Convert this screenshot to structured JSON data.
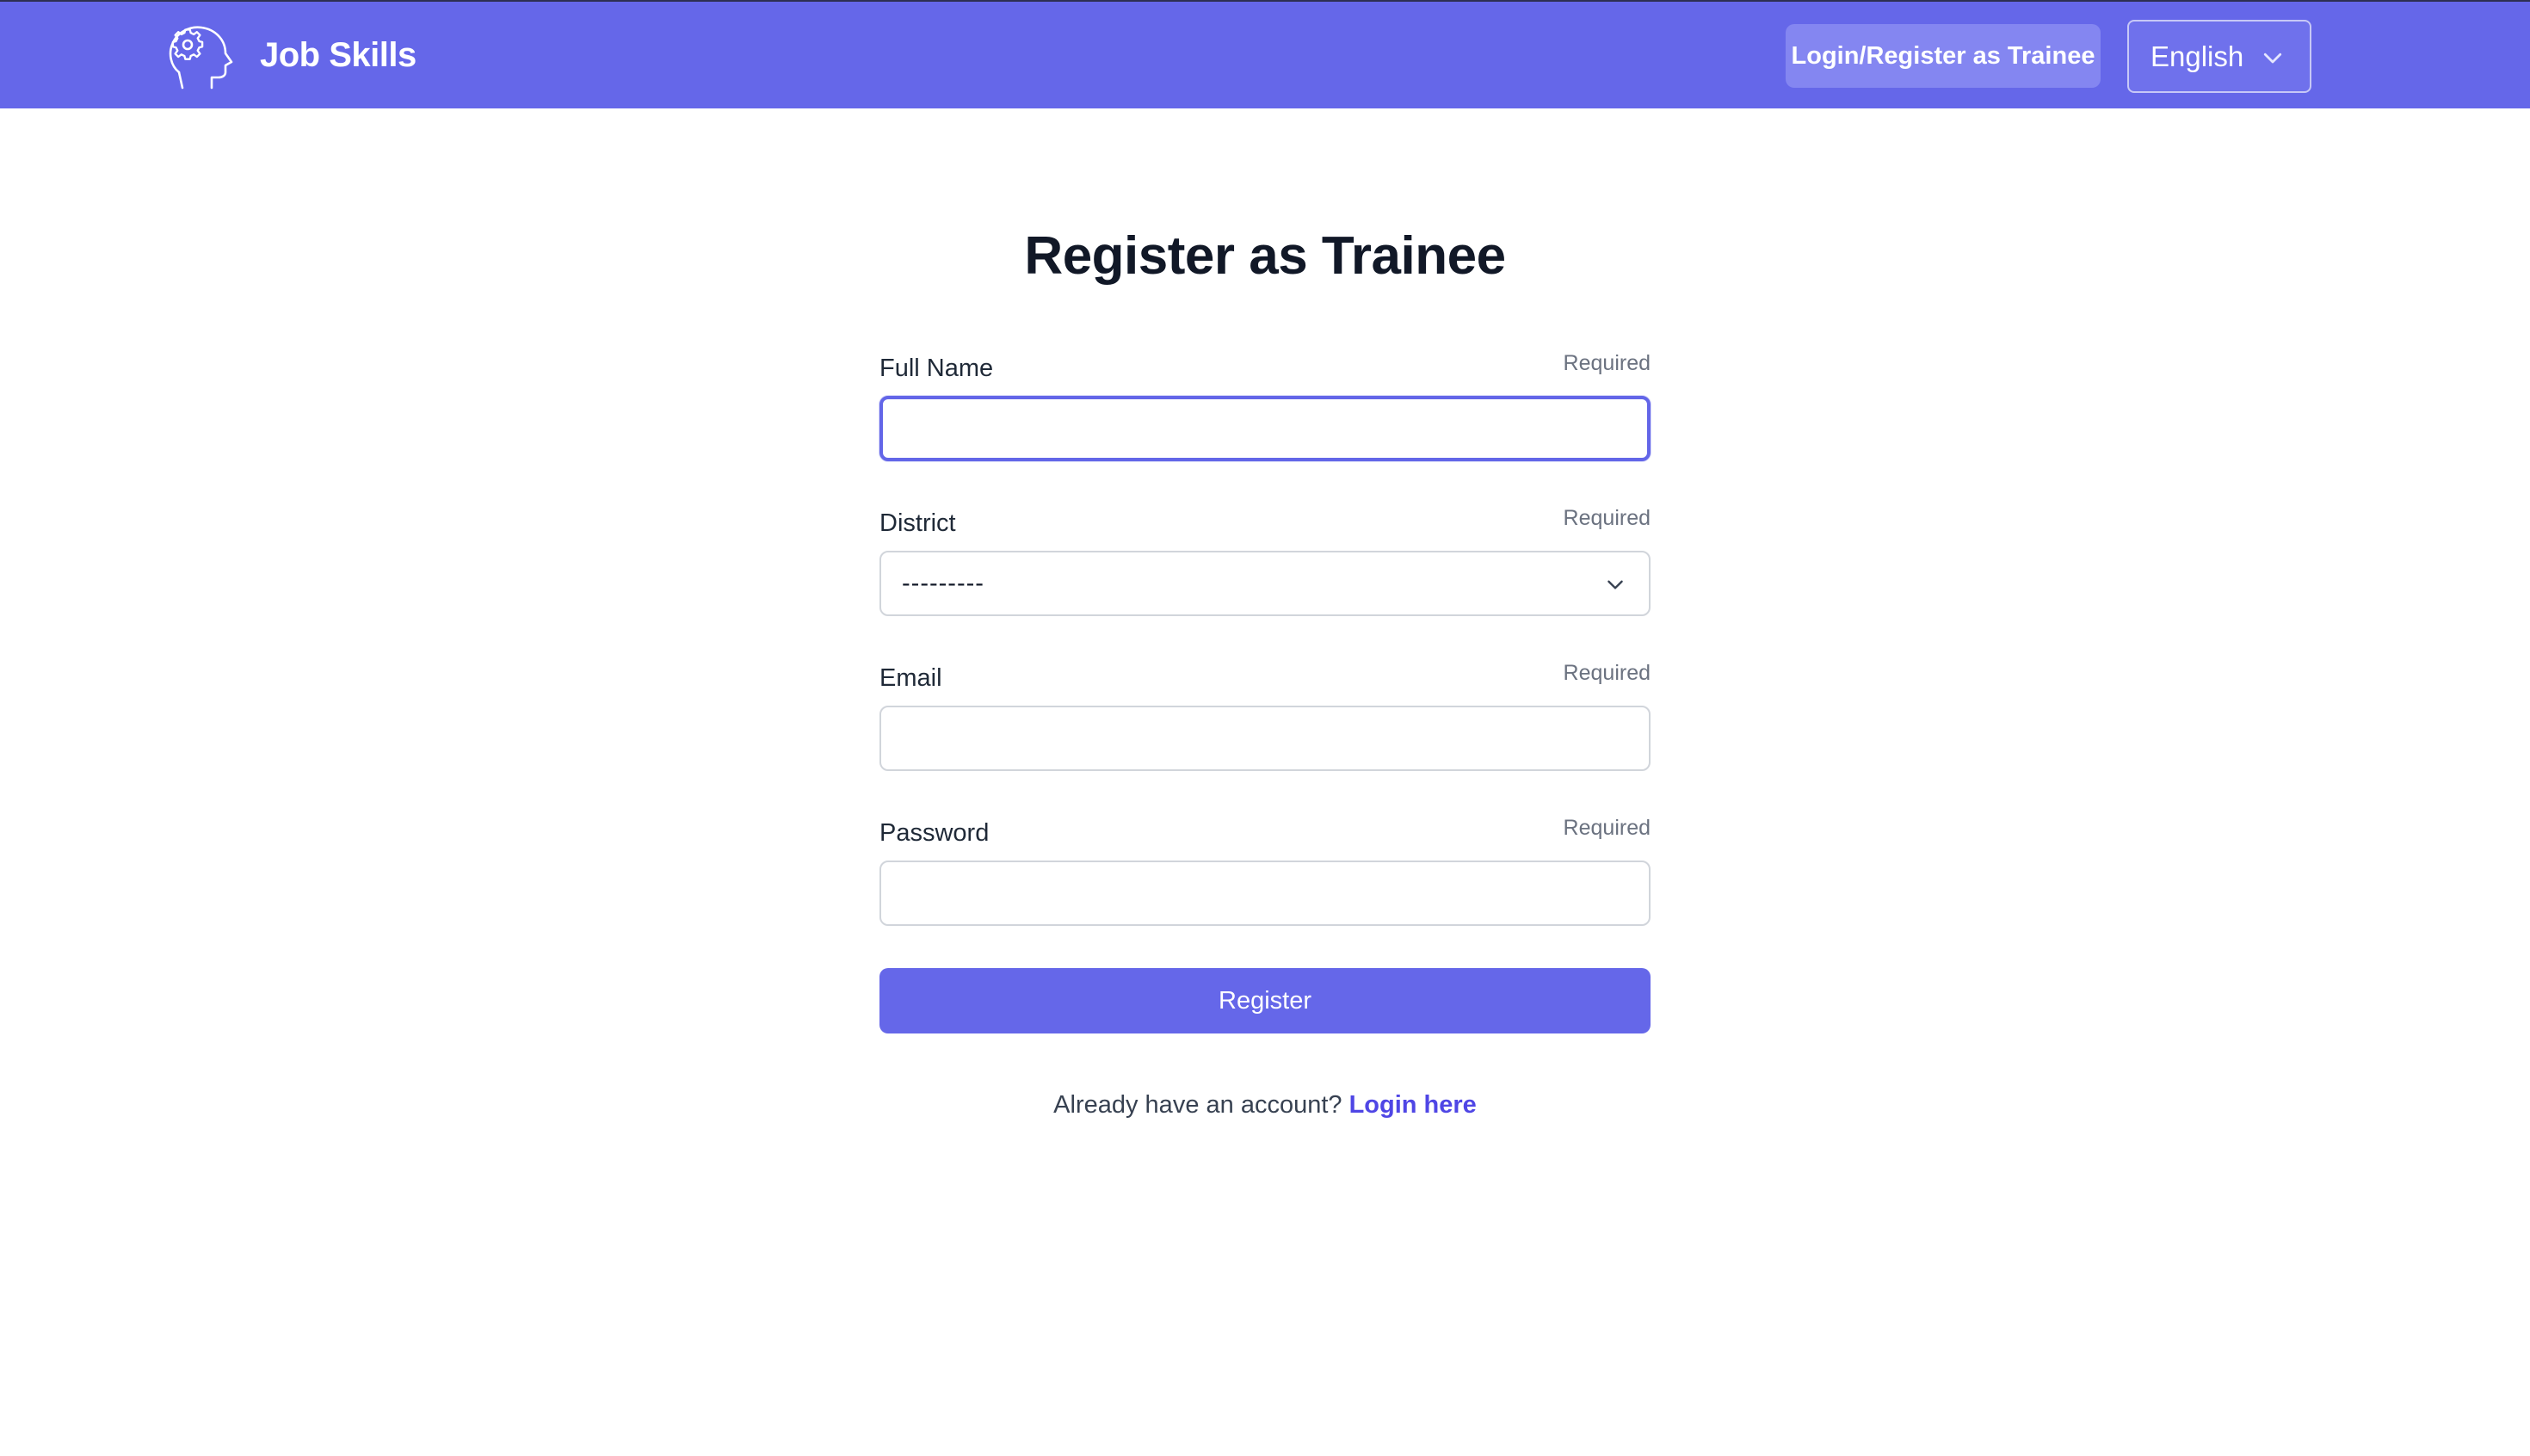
{
  "colors": {
    "brand": "#6567e9",
    "nav_button": "#8486f1",
    "link": "#4f46e5",
    "focus_ring": "#6366e8"
  },
  "navbar": {
    "brand_icon": "gear-head-icon",
    "brand_name": "Job Skills",
    "login_button_label": "Login/Register as Trainee",
    "language": {
      "selected": "English",
      "icon": "chevron-down-icon"
    }
  },
  "page": {
    "title": "Register as Trainee"
  },
  "form": {
    "full_name": {
      "label": "Full Name",
      "required": "Required",
      "value": ""
    },
    "district": {
      "label": "District",
      "required": "Required",
      "selected": "---------"
    },
    "email": {
      "label": "Email",
      "required": "Required",
      "value": ""
    },
    "password": {
      "label": "Password",
      "required": "Required",
      "value": ""
    },
    "submit_label": "Register"
  },
  "footer": {
    "prompt": "Already have an account?",
    "link_text": "Login here"
  }
}
